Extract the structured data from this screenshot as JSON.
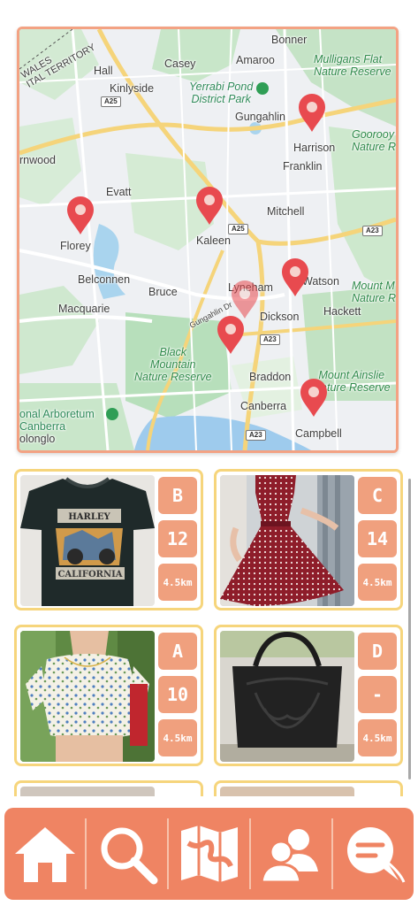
{
  "map": {
    "places": {
      "bonner": "Bonner",
      "mulligans": "Mulligans Flat\nNature Reserve",
      "casey": "Casey",
      "amaroo": "Amaroo",
      "hall": "Hall",
      "territory": "WALES\nITAL TERRITORY",
      "kinlyside": "Kinlyside",
      "yerrabi": "Yerrabi Pond\nDistrict Park",
      "gungahlin": "Gungahlin",
      "gooroo": "Goorooy\nNature R",
      "harrison": "Harrison",
      "rnwood": "rnwood",
      "franklin": "Franklin",
      "evatt": "Evatt",
      "mitchell": "Mitchell",
      "kaleen": "Kaleen",
      "florey": "Florey",
      "belconnen": "Belconnen",
      "bruce": "Bruce",
      "lyneham": "Lyneham",
      "watson": "Watson",
      "mount_maj": "Mount M\nNature R",
      "macquarie": "Macquarie",
      "gungahlin_dr": "Gungahlin Dr",
      "dickson": "Dickson",
      "hackett": "Hackett",
      "black_mountain": "Black\nMountain\nNature Reserve",
      "braddon": "Braddon",
      "mount_ainslie": "Mount Ainslie\nNature Reserve",
      "arboretum": "onal Arboretum\nCanberra",
      "canberra": "Canberra",
      "olonglo": "olonglo",
      "campbell": "Campbell"
    },
    "roads": {
      "a25_top": "A25",
      "a25_mid": "A25",
      "a23_right": "A23",
      "a23_mid": "A23",
      "a23_bottom": "A23"
    }
  },
  "listings": [
    {
      "grade": "B",
      "size": "12",
      "distance": "4.5km",
      "item": "Harley-Davidson California t-shirt"
    },
    {
      "grade": "C",
      "size": "14",
      "distance": "4.5km",
      "item": "Red polka dot dress"
    },
    {
      "grade": "A",
      "size": "10",
      "distance": "4.5km",
      "item": "Floral crop top"
    },
    {
      "grade": "D",
      "size": "-",
      "distance": "4.5km",
      "item": "Black leather tote bag"
    }
  ],
  "nav": {
    "items": [
      "home-icon",
      "search-icon",
      "map-icon",
      "friends-icon",
      "chat-icon"
    ]
  },
  "colors": {
    "accent": "#ef8463",
    "badge": "#f0a07e",
    "card_border": "#f6d57c",
    "map_border": "#f3a283",
    "pin": "#e84a4f"
  }
}
